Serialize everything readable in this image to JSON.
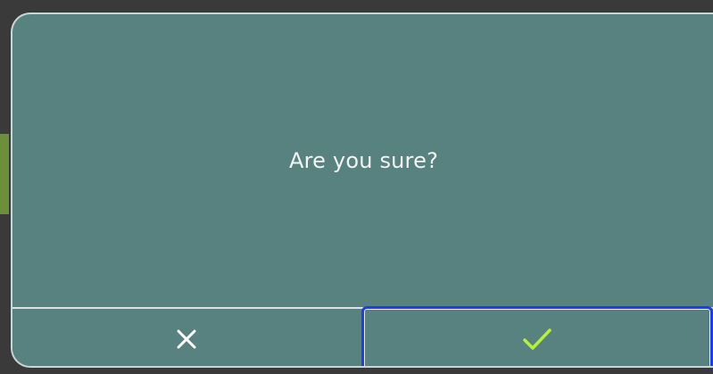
{
  "dialog": {
    "message": "Are you sure?",
    "cancel_icon": "close-icon",
    "confirm_icon": "check-icon"
  },
  "colors": {
    "dialog_background": "#588280",
    "dialog_border": "#c9d6d4",
    "message_text": "#f1f4f3",
    "cancel_icon": "#ffffff",
    "confirm_icon": "#b6f03a",
    "focus_outline": "#1f3bf5"
  }
}
